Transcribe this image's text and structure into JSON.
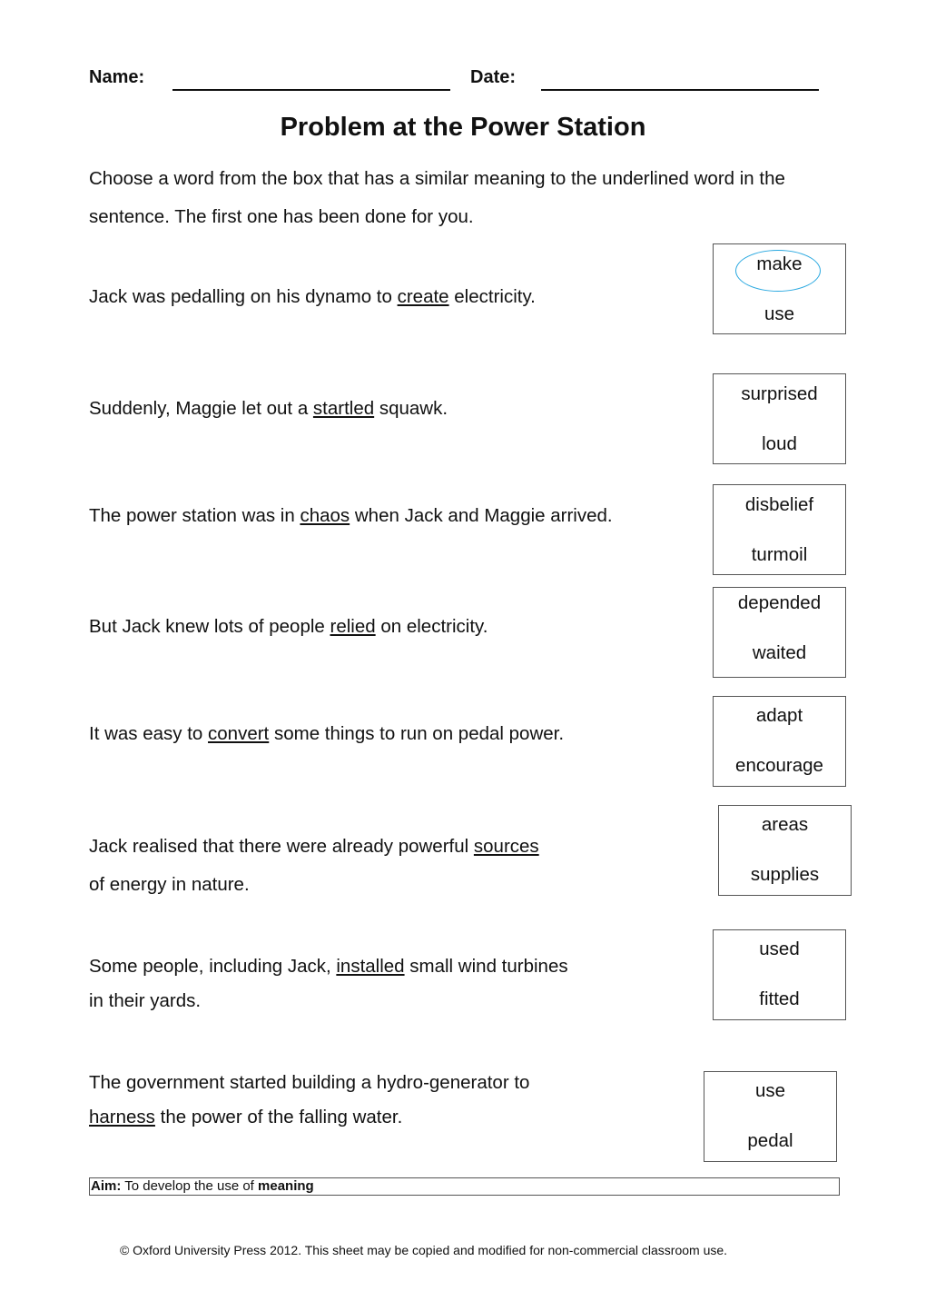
{
  "header": {
    "name_label": "Name:",
    "date_label": "Date:"
  },
  "title": "Problem at the Power Station",
  "instructions": "Choose a word from the box that has a similar meaning to the underlined word in the sentence. The first one has been done for you.",
  "questions": [
    {
      "before": "Jack was pedalling on his dynamo to ",
      "underlined": "create",
      "after": " electricity.",
      "options": [
        "make",
        "use"
      ],
      "circled": "make"
    },
    {
      "before": "Suddenly, Maggie let out a ",
      "underlined": "startled",
      "after": " squawk.",
      "options": [
        "surprised",
        "loud"
      ]
    },
    {
      "before": "The power station was in ",
      "underlined": "chaos",
      "after": " when Jack and Maggie arrived.",
      "options": [
        "disbelief",
        "turmoil"
      ]
    },
    {
      "before": "But Jack knew lots of people ",
      "underlined": "relied",
      "after": " on electricity.",
      "options": [
        "depended",
        "waited"
      ]
    },
    {
      "before": "It was easy to ",
      "underlined": "convert",
      "after": " some things to run on pedal power.",
      "options": [
        "adapt",
        "encourage"
      ]
    },
    {
      "before": "Jack realised that there were already powerful ",
      "underlined": "sources",
      "after": "",
      "line2": "of energy in nature.",
      "options": [
        "areas",
        "supplies"
      ]
    },
    {
      "before": "Some people, including Jack, ",
      "underlined": "installed",
      "after": " small wind turbines",
      "line2": "in their yards.",
      "options": [
        "used",
        "fitted"
      ]
    },
    {
      "before": "The government started building a hydro-generator to",
      "underlined": "harness",
      "after": " the power of the falling water.",
      "options": [
        "use",
        "pedal"
      ]
    }
  ],
  "aim": {
    "label": "Aim:",
    "text": " To develop the use of ",
    "focus": "meaning"
  },
  "footer": "© Oxford University Press 2012. This sheet may be copied and modified for non-commercial classroom use.",
  "colors": {
    "circle": "#29a8e0"
  }
}
